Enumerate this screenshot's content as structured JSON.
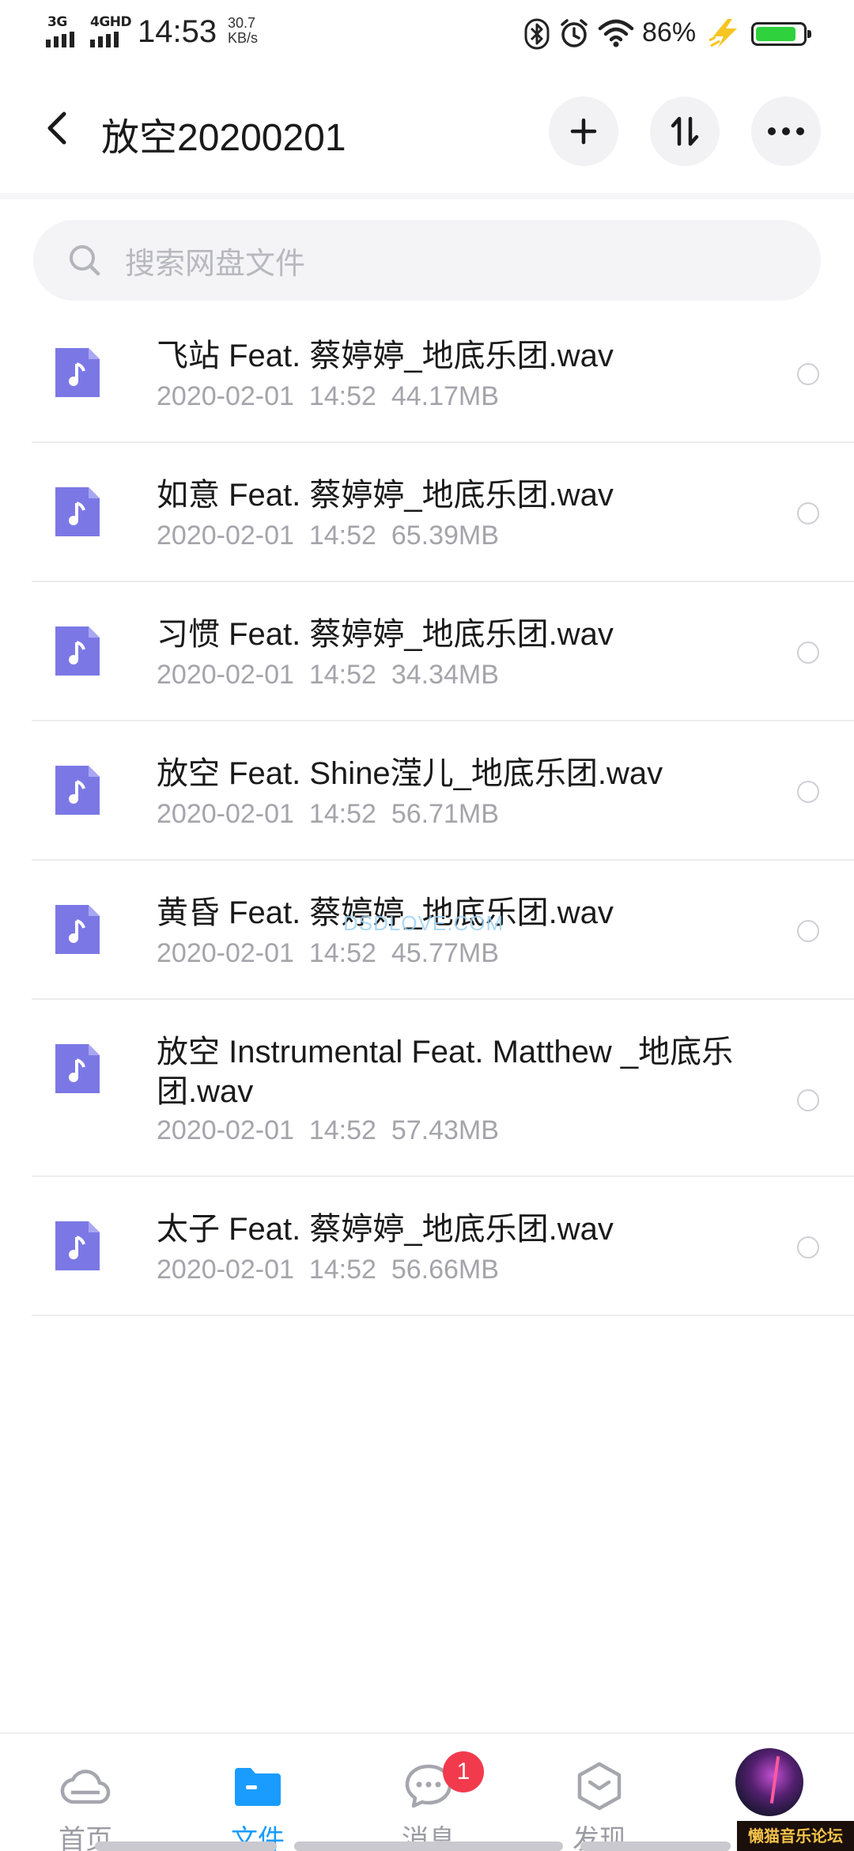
{
  "status_bar": {
    "net1": "3G",
    "net2": "4GHD",
    "time": "14:53",
    "speed_value": "30.7",
    "speed_unit": "KB/s",
    "battery_percent": "86%",
    "battery_level": 0.86,
    "battery_color": "#2fd13c",
    "icons": [
      "bluetooth-icon",
      "alarm-icon",
      "wifi-icon",
      "charging-bolt-icon"
    ]
  },
  "header": {
    "title": "放空20200201",
    "actions": [
      "add-icon",
      "sort-icon",
      "more-icon"
    ]
  },
  "search": {
    "placeholder": "搜索网盘文件"
  },
  "files": [
    {
      "name": "飞站 Feat. 蔡婷婷_地底乐团.wav",
      "date": "2020-02-01",
      "time": "14:52",
      "size": "44.17MB"
    },
    {
      "name": "如意 Feat. 蔡婷婷_地底乐团.wav",
      "date": "2020-02-01",
      "time": "14:52",
      "size": "65.39MB"
    },
    {
      "name": "习惯 Feat. 蔡婷婷_地底乐团.wav",
      "date": "2020-02-01",
      "time": "14:52",
      "size": "34.34MB"
    },
    {
      "name": "放空 Feat. Shine滢儿_地底乐团.wav",
      "date": "2020-02-01",
      "time": "14:52",
      "size": "56.71MB"
    },
    {
      "name": "黄昏 Feat. 蔡婷婷_地底乐团.wav",
      "date": "2020-02-01",
      "time": "14:52",
      "size": "45.77MB"
    },
    {
      "name": "放空 Instrumental Feat. Matthew _地底乐团.wav",
      "date": "2020-02-01",
      "time": "14:52",
      "size": "57.43MB"
    },
    {
      "name": "太子 Feat. 蔡婷婷_地底乐团.wav",
      "date": "2020-02-01",
      "time": "14:52",
      "size": "56.66MB"
    }
  ],
  "watermark": "DSDLOVE.COM",
  "bottom_nav": {
    "items": [
      {
        "label": "首页",
        "icon": "cloud-icon"
      },
      {
        "label": "文件",
        "icon": "folder-icon"
      },
      {
        "label": "消息",
        "icon": "chat-icon",
        "badge": "1"
      },
      {
        "label": "发现",
        "icon": "discover-icon"
      }
    ],
    "active_color": "#1a9cff",
    "badge_color": "#f23a4d"
  },
  "corner_logo": "懒猫音乐论坛"
}
